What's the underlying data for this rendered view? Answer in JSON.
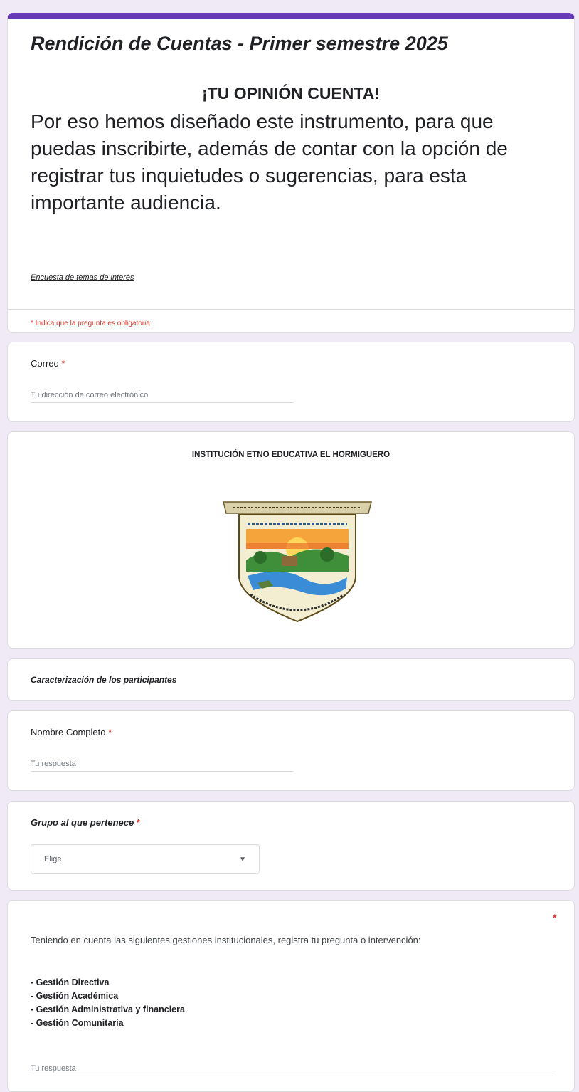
{
  "header": {
    "title": "Rendición de Cuentas - Primer semestre 2025",
    "slogan": "¡TU OPINIÓN CUENTA!",
    "intro": "Por eso hemos diseñado este instrumento, para que puedas inscribirte, además de contar con la opción de registrar tus inquietudes o sugerencias, para esta importante audiencia.",
    "survey_link": "Encuesta de temas de interés",
    "required_note": "* Indica que la pregunta es obligatoria"
  },
  "email": {
    "label": "Correo",
    "required_mark": "*",
    "placeholder": "Tu dirección de correo electrónico"
  },
  "image_card": {
    "school_name": "INSTITUCIÓN ETNO EDUCATIVA EL HORMIGUERO"
  },
  "section": {
    "title": "Caracterización de los participantes"
  },
  "name_question": {
    "label": "Nombre Completo",
    "required_mark": "*",
    "placeholder": "Tu respuesta"
  },
  "group_question": {
    "label": "Grupo al que pertenece",
    "required_mark": "*",
    "select_value": "Elige",
    "caret_icon": "dropdown-caret-icon"
  },
  "management_question": {
    "required_mark": "*",
    "description": "Teniendo en cuenta las siguientes gestiones institucionales, registra tu pregunta o intervención:",
    "items": [
      "- Gestión Directiva",
      "- Gestión Académica",
      "- Gestión Administrativa y financiera",
      "- Gestión Comunitaria"
    ],
    "placeholder": "Tu respuesta"
  },
  "colors": {
    "accent": "#673ab7",
    "required": "#d93025",
    "background": "#efeaf6"
  }
}
